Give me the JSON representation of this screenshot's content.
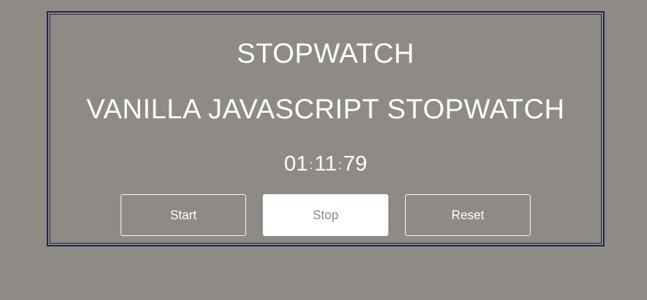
{
  "stopwatch": {
    "title": "STOPWATCH",
    "subtitle": "VANILLA JAVASCRIPT STOPWATCH",
    "time": {
      "minutes": "01",
      "seconds": "11",
      "hundredths": "79",
      "separator": ":"
    }
  },
  "controls": {
    "start_label": "Start",
    "stop_label": "Stop",
    "reset_label": "Reset",
    "active": "stop"
  },
  "colors": {
    "background": "#8e8a85",
    "border": "#23224a",
    "text": "#ffffff"
  }
}
